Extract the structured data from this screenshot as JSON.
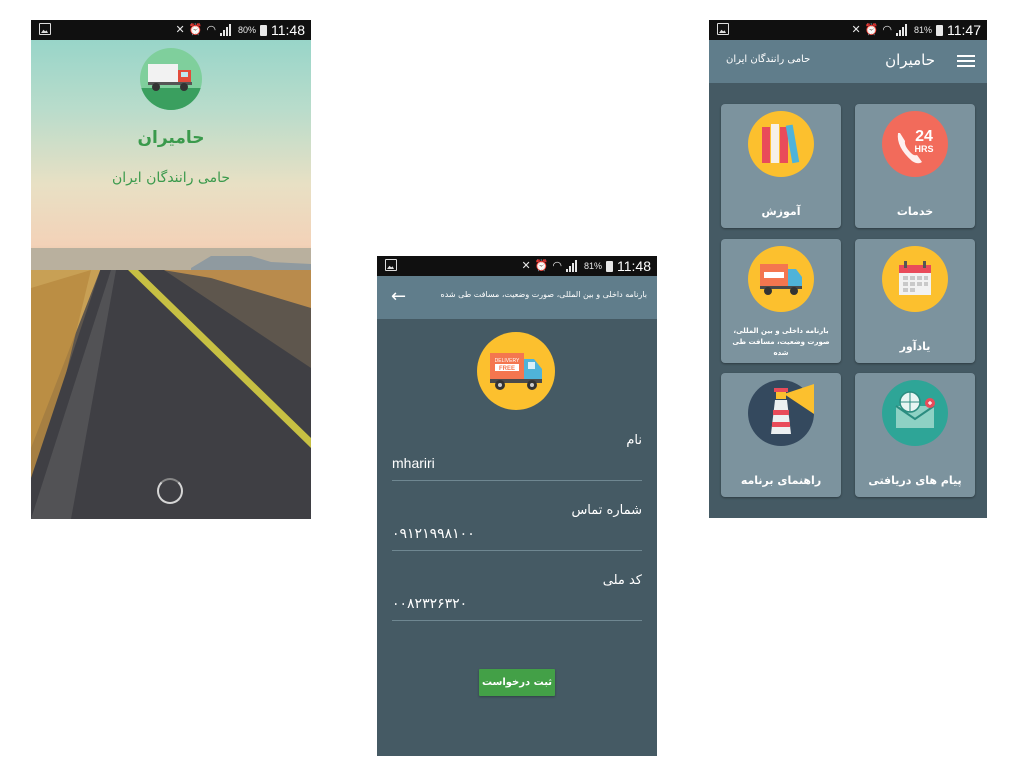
{
  "screen1": {
    "status": {
      "battery": "80%",
      "time": "11:48"
    },
    "app_title": "حامیران",
    "app_subtitle": "حامی رانندگان ایران"
  },
  "screen2": {
    "status": {
      "battery": "81%",
      "time": "11:48"
    },
    "header_title": "بارنامه داخلی و بین المللی، صورت وضعیت، مسافت طی شده",
    "fields": [
      {
        "label": "نام",
        "value": "mhariri"
      },
      {
        "label": "شماره تماس",
        "value": "۰۹۱۲۱۹۹۸۱۰۰"
      },
      {
        "label": "کد ملی",
        "value": "۰۰۸۲۳۲۶۳۲۰"
      }
    ],
    "submit_label": "ثبت درخواست"
  },
  "screen3": {
    "status": {
      "battery": "81%",
      "time": "11:47"
    },
    "header_title": "حامیران",
    "header_subtitle": "حامی رانندگان ایران",
    "tiles": [
      {
        "label": "خدمات",
        "icon": "24hrs-phone-icon"
      },
      {
        "label": "آموزش",
        "icon": "books-icon"
      },
      {
        "label": "یادآور",
        "icon": "calendar-icon"
      },
      {
        "label": "بارنامه داخلی و بین المللی، صورت وضعیت، مسافت طی شده",
        "icon": "delivery-truck-icon"
      },
      {
        "label": "پیام های دریافتی",
        "icon": "message-envelope-icon"
      },
      {
        "label": "راهنمای برنامه",
        "icon": "lighthouse-icon"
      }
    ],
    "icon_text_24": "24",
    "icon_text_hrs": "HRS"
  },
  "colors": {
    "accent_green": "#43a047",
    "header": "#607d8b",
    "background": "#455a64"
  }
}
